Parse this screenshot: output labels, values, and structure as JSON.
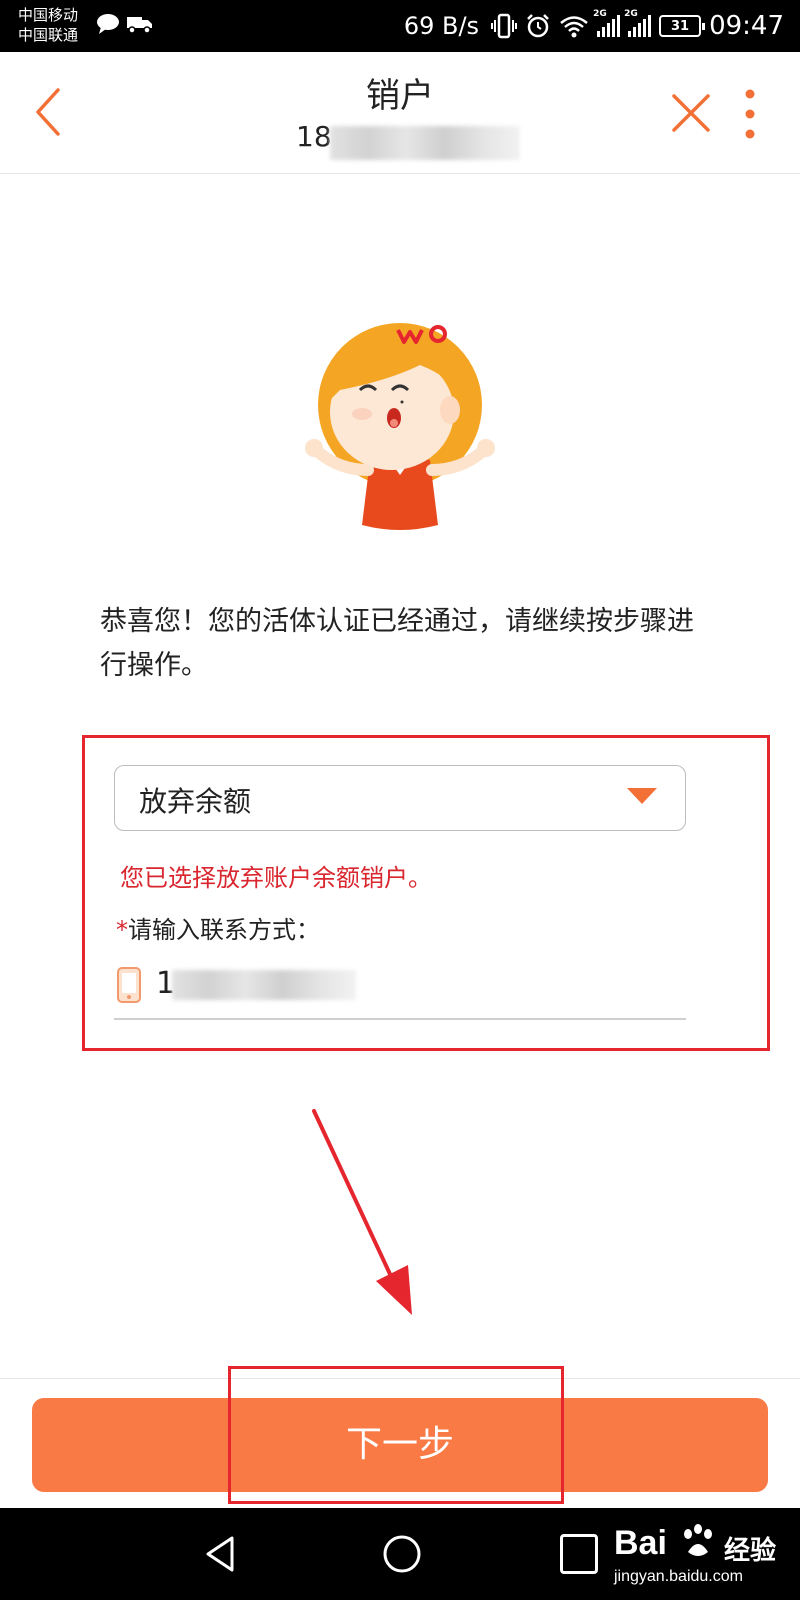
{
  "status_bar": {
    "carrier_1": "中国移动",
    "carrier_2": "中国联通",
    "net_speed": "69 B/s",
    "signal_tag_1": "2G",
    "signal_tag_2": "2G",
    "battery": "31",
    "time": "09:47"
  },
  "header": {
    "title": "销户",
    "subtitle_visible": "18",
    "back_icon": "chevron-left-icon",
    "close_icon": "close-icon",
    "more_icon": "more-vertical-icon"
  },
  "main": {
    "message": "恭喜您！您的活体认证已经通过，请继续按步骤进行操作。"
  },
  "form": {
    "select_value": "放弃余额",
    "notice": "您已选择放弃账户余额销户。",
    "required_mark": "*",
    "contact_label": "请输入联系方式：",
    "contact_value_visible": "1"
  },
  "actions": {
    "next_label": "下一步"
  },
  "watermark": {
    "brand": "Bai",
    "product": "经验",
    "url": "jingyan.baidu.com"
  },
  "colors": {
    "accent": "#f97a45",
    "annotation_red": "#e5262f",
    "notice_red": "#d9262f"
  }
}
